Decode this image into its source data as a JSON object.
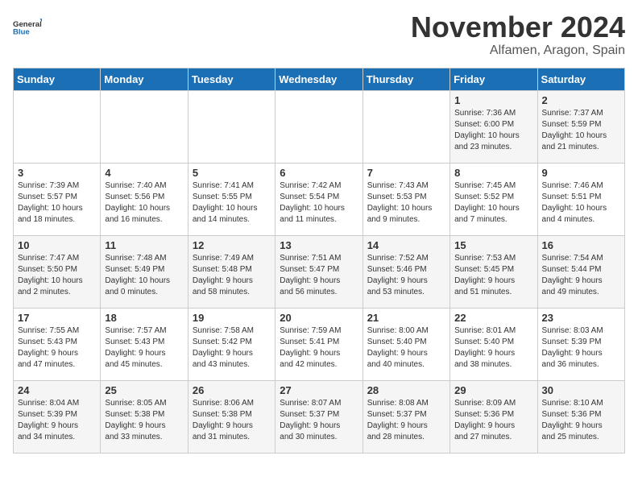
{
  "logo": {
    "line1": "General",
    "line2": "Blue"
  },
  "title": "November 2024",
  "location": "Alfamen, Aragon, Spain",
  "weekdays": [
    "Sunday",
    "Monday",
    "Tuesday",
    "Wednesday",
    "Thursday",
    "Friday",
    "Saturday"
  ],
  "weeks": [
    [
      {
        "day": "",
        "info": ""
      },
      {
        "day": "",
        "info": ""
      },
      {
        "day": "",
        "info": ""
      },
      {
        "day": "",
        "info": ""
      },
      {
        "day": "",
        "info": ""
      },
      {
        "day": "1",
        "info": "Sunrise: 7:36 AM\nSunset: 6:00 PM\nDaylight: 10 hours\nand 23 minutes."
      },
      {
        "day": "2",
        "info": "Sunrise: 7:37 AM\nSunset: 5:59 PM\nDaylight: 10 hours\nand 21 minutes."
      }
    ],
    [
      {
        "day": "3",
        "info": "Sunrise: 7:39 AM\nSunset: 5:57 PM\nDaylight: 10 hours\nand 18 minutes."
      },
      {
        "day": "4",
        "info": "Sunrise: 7:40 AM\nSunset: 5:56 PM\nDaylight: 10 hours\nand 16 minutes."
      },
      {
        "day": "5",
        "info": "Sunrise: 7:41 AM\nSunset: 5:55 PM\nDaylight: 10 hours\nand 14 minutes."
      },
      {
        "day": "6",
        "info": "Sunrise: 7:42 AM\nSunset: 5:54 PM\nDaylight: 10 hours\nand 11 minutes."
      },
      {
        "day": "7",
        "info": "Sunrise: 7:43 AM\nSunset: 5:53 PM\nDaylight: 10 hours\nand 9 minutes."
      },
      {
        "day": "8",
        "info": "Sunrise: 7:45 AM\nSunset: 5:52 PM\nDaylight: 10 hours\nand 7 minutes."
      },
      {
        "day": "9",
        "info": "Sunrise: 7:46 AM\nSunset: 5:51 PM\nDaylight: 10 hours\nand 4 minutes."
      }
    ],
    [
      {
        "day": "10",
        "info": "Sunrise: 7:47 AM\nSunset: 5:50 PM\nDaylight: 10 hours\nand 2 minutes."
      },
      {
        "day": "11",
        "info": "Sunrise: 7:48 AM\nSunset: 5:49 PM\nDaylight: 10 hours\nand 0 minutes."
      },
      {
        "day": "12",
        "info": "Sunrise: 7:49 AM\nSunset: 5:48 PM\nDaylight: 9 hours\nand 58 minutes."
      },
      {
        "day": "13",
        "info": "Sunrise: 7:51 AM\nSunset: 5:47 PM\nDaylight: 9 hours\nand 56 minutes."
      },
      {
        "day": "14",
        "info": "Sunrise: 7:52 AM\nSunset: 5:46 PM\nDaylight: 9 hours\nand 53 minutes."
      },
      {
        "day": "15",
        "info": "Sunrise: 7:53 AM\nSunset: 5:45 PM\nDaylight: 9 hours\nand 51 minutes."
      },
      {
        "day": "16",
        "info": "Sunrise: 7:54 AM\nSunset: 5:44 PM\nDaylight: 9 hours\nand 49 minutes."
      }
    ],
    [
      {
        "day": "17",
        "info": "Sunrise: 7:55 AM\nSunset: 5:43 PM\nDaylight: 9 hours\nand 47 minutes."
      },
      {
        "day": "18",
        "info": "Sunrise: 7:57 AM\nSunset: 5:43 PM\nDaylight: 9 hours\nand 45 minutes."
      },
      {
        "day": "19",
        "info": "Sunrise: 7:58 AM\nSunset: 5:42 PM\nDaylight: 9 hours\nand 43 minutes."
      },
      {
        "day": "20",
        "info": "Sunrise: 7:59 AM\nSunset: 5:41 PM\nDaylight: 9 hours\nand 42 minutes."
      },
      {
        "day": "21",
        "info": "Sunrise: 8:00 AM\nSunset: 5:40 PM\nDaylight: 9 hours\nand 40 minutes."
      },
      {
        "day": "22",
        "info": "Sunrise: 8:01 AM\nSunset: 5:40 PM\nDaylight: 9 hours\nand 38 minutes."
      },
      {
        "day": "23",
        "info": "Sunrise: 8:03 AM\nSunset: 5:39 PM\nDaylight: 9 hours\nand 36 minutes."
      }
    ],
    [
      {
        "day": "24",
        "info": "Sunrise: 8:04 AM\nSunset: 5:39 PM\nDaylight: 9 hours\nand 34 minutes."
      },
      {
        "day": "25",
        "info": "Sunrise: 8:05 AM\nSunset: 5:38 PM\nDaylight: 9 hours\nand 33 minutes."
      },
      {
        "day": "26",
        "info": "Sunrise: 8:06 AM\nSunset: 5:38 PM\nDaylight: 9 hours\nand 31 minutes."
      },
      {
        "day": "27",
        "info": "Sunrise: 8:07 AM\nSunset: 5:37 PM\nDaylight: 9 hours\nand 30 minutes."
      },
      {
        "day": "28",
        "info": "Sunrise: 8:08 AM\nSunset: 5:37 PM\nDaylight: 9 hours\nand 28 minutes."
      },
      {
        "day": "29",
        "info": "Sunrise: 8:09 AM\nSunset: 5:36 PM\nDaylight: 9 hours\nand 27 minutes."
      },
      {
        "day": "30",
        "info": "Sunrise: 8:10 AM\nSunset: 5:36 PM\nDaylight: 9 hours\nand 25 minutes."
      }
    ]
  ]
}
